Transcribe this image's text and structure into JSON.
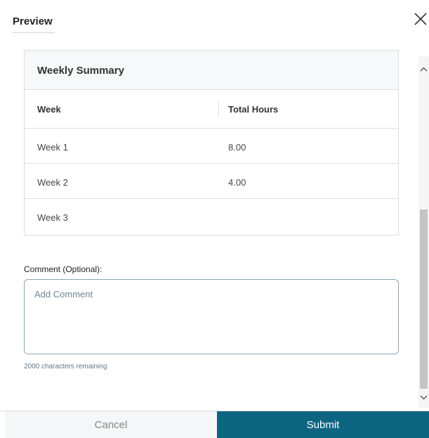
{
  "header": {
    "tab_label": "Preview",
    "close_icon": "close-icon"
  },
  "summary": {
    "title": "Weekly Summary",
    "columns": [
      "Week",
      "Total Hours"
    ],
    "rows": [
      {
        "week": "Week 1",
        "hours": "8.00"
      },
      {
        "week": "Week 2",
        "hours": "4.00"
      },
      {
        "week": "Week 3",
        "hours": ""
      }
    ]
  },
  "comment": {
    "label": "Comment (Optional):",
    "placeholder": "Add Comment",
    "value": "",
    "chars_remaining": "2000 characters remaining"
  },
  "footer": {
    "cancel_label": "Cancel",
    "submit_label": "Submit"
  },
  "colors": {
    "submit_bg": "#0e6582",
    "cancel_bg": "#f5f6f7",
    "input_border": "#8aa6b8"
  }
}
